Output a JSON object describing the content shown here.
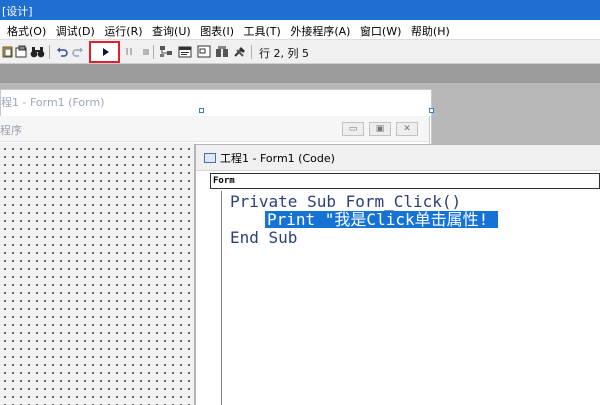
{
  "window": {
    "title": "[设计]"
  },
  "menu": {
    "items": [
      "格式(O)",
      "调试(D)",
      "运行(R)",
      "查询(U)",
      "图表(I)",
      "工具(T)",
      "外接程序(A)",
      "窗口(W)",
      "帮助(H)"
    ]
  },
  "toolbar": {
    "icons": [
      "paste-icon",
      "find-icon",
      "binoculars-icon",
      "undo-icon",
      "redo-icon",
      "run-icon",
      "break-icon",
      "stop-icon",
      "project-explorer-icon",
      "properties-icon",
      "form-layout-icon",
      "object-browser-icon",
      "toolbox-icon"
    ],
    "position_text": "行 2, 列 5"
  },
  "form_designer": {
    "title": "程1 - Form1 (Form)"
  },
  "form1": {
    "title": "程序",
    "buttons": [
      "minimize",
      "restore",
      "close"
    ]
  },
  "code_window": {
    "title": "工程1 - Form1 (Code)",
    "object_combo": "Form",
    "lines": [
      "Private Sub Form_Click()",
      "Print \"我是Click单击属性! \"",
      "End Sub"
    ],
    "selected_line_index": 1
  },
  "colors": {
    "title_bar": "#1f6fd0",
    "highlight": "#e0202c",
    "selection": "#1673d6",
    "code_text": "#2b3f7a"
  }
}
